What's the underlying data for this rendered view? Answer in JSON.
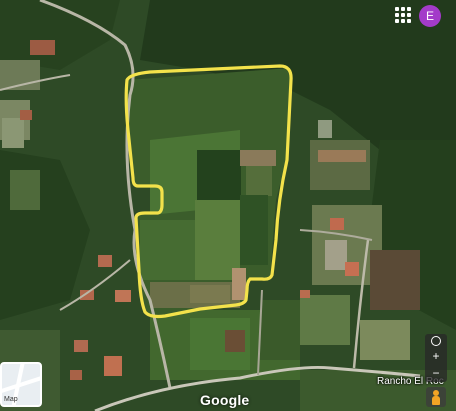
{
  "map": {
    "view": "satellite",
    "place_label": "Rancho El Roc",
    "attribution_logo": "Google",
    "parcel_outline_color": "#f3e24b",
    "layer_toggle_label": "Map"
  },
  "header": {
    "apps_icon": "apps-grid-icon",
    "avatar_initial": "E",
    "avatar_color": "#a33bc9"
  },
  "controls": {
    "zoom_in": "+",
    "zoom_out": "−",
    "compass_icon": "compass-icon",
    "pegman_icon": "pegman-icon",
    "pegman_color": "#f2a425"
  }
}
